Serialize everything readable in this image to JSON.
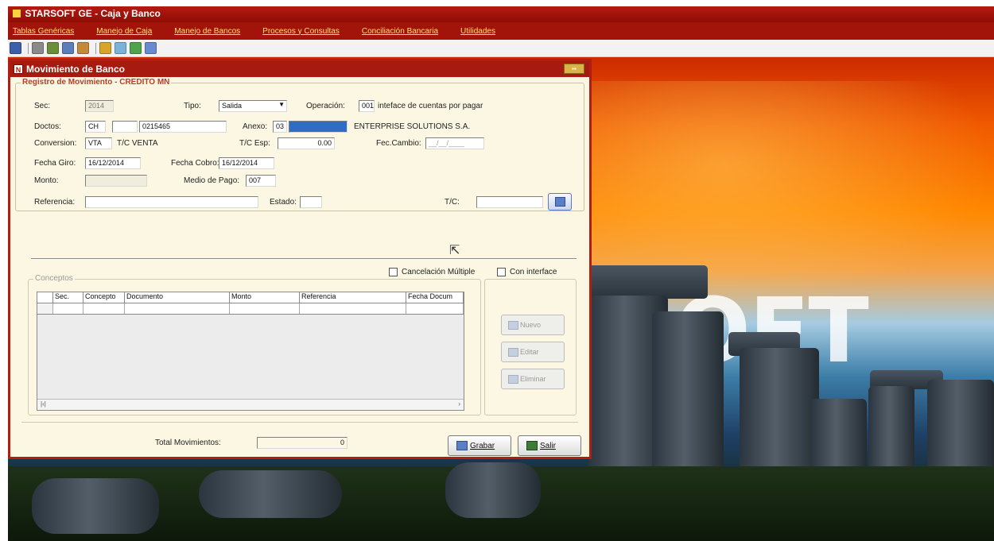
{
  "app": {
    "title": "STARSOFT GE  - Caja y Banco"
  },
  "menu": [
    "Tablas Genéricas",
    "Manejo de Caja",
    "Manejo de Bancos",
    "Procesos y Consultas",
    "Conciliación Bancaria",
    "Utilidades"
  ],
  "desktop": {
    "watermark": "SOFT"
  },
  "window": {
    "title": "Movimiento de Banco",
    "group_title": "Registro de Movimiento - CREDITO MN",
    "fields": {
      "sec_label": "Sec:",
      "sec_value": "2014",
      "tipo_label": "Tipo:",
      "tipo_value": "Salida",
      "operacion_label": "Operación:",
      "operacion_code": "001",
      "operacion_desc": "inteface de cuentas por pagar",
      "doctos_label": "Doctos:",
      "doctos_tipo": "CH",
      "doctos_serie": "",
      "doctos_numero": "0215465",
      "anexo_label": "Anexo:",
      "anexo_code": "03",
      "anexo_value": "",
      "anexo_name": "ENTERPRISE SOLUTIONS S.A.",
      "conversion_label": "Conversion:",
      "conversion_value": "VTA",
      "conversion_desc": "T/C VENTA",
      "tc_esp_label": "T/C Esp:",
      "tc_esp_value": "0.00",
      "fec_cambio_label": "Fec.Cambio:",
      "fec_cambio_value": "__/__/____",
      "fecha_giro_label": "Fecha Giro:",
      "fecha_giro_value": "16/12/2014",
      "fecha_cobro_label": "Fecha Cobro:",
      "fecha_cobro_value": "16/12/2014",
      "monto_label": "Monto:",
      "monto_value": "",
      "medio_pago_label": "Medio de Pago:",
      "medio_pago_value": "007",
      "referencia_label": "Referencia:",
      "referencia_value": "",
      "estado_label": "Estado:",
      "estado_value": "",
      "tc_label": "T/C:",
      "tc_value": ""
    },
    "checkboxes": {
      "cancelacion_multiple": "Cancelación Múltiple",
      "con_interface": "Con interface"
    },
    "conceptos": {
      "title": "Conceptos",
      "columns": [
        "",
        "Sec.",
        "Concepto",
        "Documento",
        "Monto",
        "Referencia",
        "Fecha Docum"
      ]
    },
    "side_buttons": {
      "nuevo": "Nuevo",
      "editar": "Editar",
      "eliminar": "Eliminar"
    },
    "totals": {
      "label": "Total Movimientos:",
      "value": "0"
    },
    "actions": {
      "grabar": "Grabar",
      "salir": "Salir"
    }
  },
  "colors": {
    "titlebar": "#b51a10",
    "menu_text": "#ffe36a",
    "window_bg": "#fbf7e2",
    "group_title": "#c0392b",
    "selection": "#2f6cc6"
  }
}
